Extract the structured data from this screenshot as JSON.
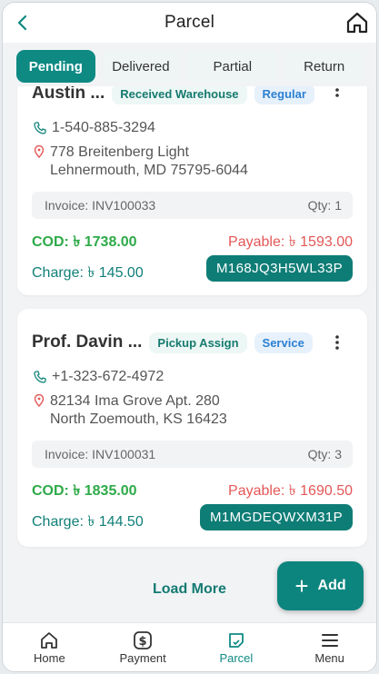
{
  "header": {
    "title": "Parcel"
  },
  "tabs": [
    {
      "label": "Pending",
      "active": true
    },
    {
      "label": "Delivered",
      "active": false
    },
    {
      "label": "Partial",
      "active": false
    },
    {
      "label": "Return",
      "active": false
    }
  ],
  "cards": [
    {
      "name": "Austin ...",
      "badge_status": "Received Warehouse",
      "badge_type": "Regular",
      "phone": "1-540-885-3294",
      "address_line1": "778 Breitenberg Light",
      "address_line2": "Lehnermouth, MD 75795-6044",
      "invoice": "Invoice: INV100033",
      "qty": "Qty: 1",
      "cod": "COD: ৳ 1738.00",
      "payable": "Payable: ৳ 1593.00",
      "charge": "Charge: ৳ 145.00",
      "tracking": "M168JQ3H5WL33P"
    },
    {
      "name": "Prof. Davin ...",
      "badge_status": "Pickup Assign",
      "badge_type": "Service",
      "phone": "+1-323-672-4972",
      "address_line1": "82134 Ima Grove Apt. 280",
      "address_line2": "North Zoemouth, KS 16423",
      "invoice": "Invoice: INV100031",
      "qty": "Qty: 3",
      "cod": "COD: ৳ 1835.00",
      "payable": "Payable: ৳ 1690.50",
      "charge": "Charge: ৳ 144.50",
      "tracking": "M1MGDEQWXM31P"
    }
  ],
  "load_more": "Load More",
  "add_button": {
    "label": "Add",
    "icon": "+"
  },
  "bottom_nav": [
    {
      "label": "Home",
      "icon": "home-icon"
    },
    {
      "label": "Payment",
      "icon": "payment-icon"
    },
    {
      "label": "Parcel",
      "icon": "parcel-icon",
      "active": true
    },
    {
      "label": "Menu",
      "icon": "menu-icon"
    }
  ],
  "colors": {
    "primary": "#0e8a83",
    "cod": "#2eaa48",
    "payable": "#e45757"
  }
}
